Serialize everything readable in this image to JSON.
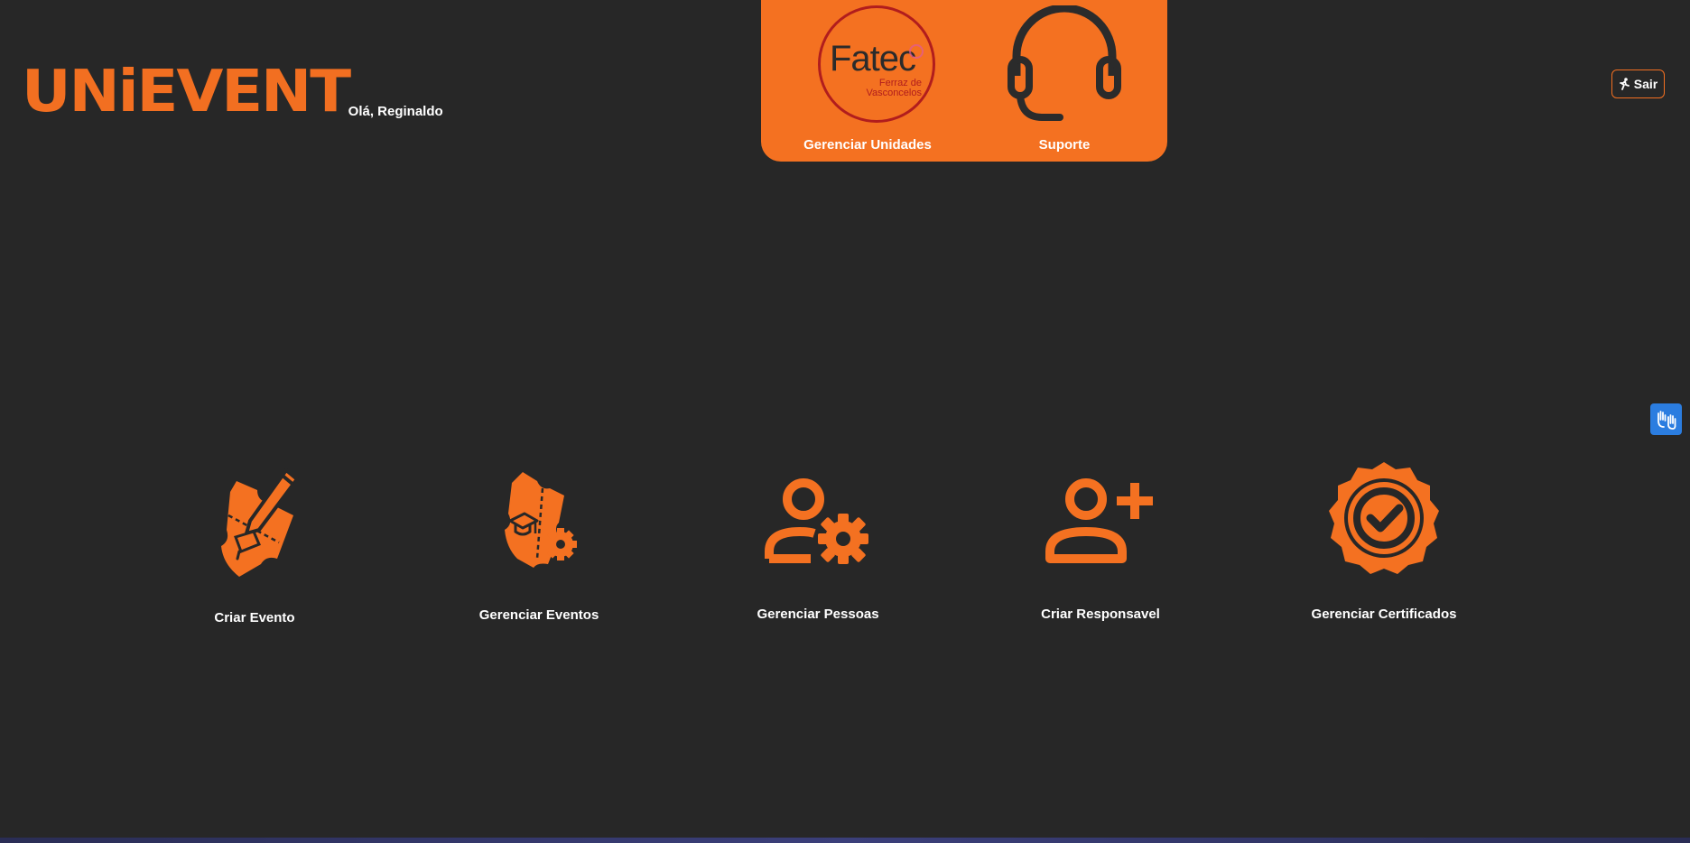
{
  "brand": {
    "logo_text": "UNiEVENT",
    "greeting": "Olá, Reginaldo",
    "accent": "#f26f21"
  },
  "top_nav": {
    "items": [
      {
        "label": "Gerenciar Unidades",
        "icon": "fatec-logo-icon",
        "badge_title": "Fatec",
        "badge_subtitle": "Ferraz de Vasconcelos"
      },
      {
        "label": "Suporte",
        "icon": "headset-icon"
      }
    ]
  },
  "header_actions": {
    "logout_label": "Sair",
    "logout_icon": "running-person-icon"
  },
  "accessibility": {
    "icon": "sign-language-hands-icon",
    "color": "#2b7de0"
  },
  "actions": [
    {
      "label": "Criar Evento",
      "icon": "ticket-pencil-icon"
    },
    {
      "label": "Gerenciar Eventos",
      "icon": "ticket-graduation-gear-icon"
    },
    {
      "label": "Gerenciar Pessoas",
      "icon": "person-gear-icon"
    },
    {
      "label": "Criar Responsavel",
      "icon": "person-add-icon"
    },
    {
      "label": "Gerenciar Certificados",
      "icon": "certificate-badge-check-icon"
    }
  ],
  "colors": {
    "background": "#272727",
    "panel": "#f47121",
    "icon_orange": "#f47121",
    "dark_stroke": "#2b2b2b",
    "fatec_red": "#b11d1d"
  }
}
